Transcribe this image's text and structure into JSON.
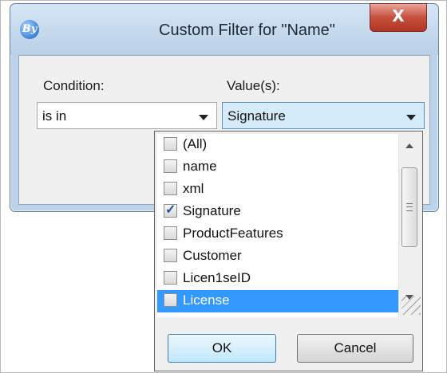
{
  "dialog": {
    "title": "Custom Filter for \"Name\"",
    "app_icon": "app-logo-icon",
    "app_icon_text": "By",
    "close_label": "X"
  },
  "condition": {
    "label": "Condition:",
    "selected": "is in"
  },
  "values": {
    "label": "Value(s):",
    "selected": "Signature"
  },
  "list_items": [
    {
      "label": "(All)",
      "checked": false,
      "highlighted": false
    },
    {
      "label": "name",
      "checked": false,
      "highlighted": false
    },
    {
      "label": "xml",
      "checked": false,
      "highlighted": false
    },
    {
      "label": "Signature",
      "checked": true,
      "highlighted": false
    },
    {
      "label": "ProductFeatures",
      "checked": false,
      "highlighted": false
    },
    {
      "label": "Customer",
      "checked": false,
      "highlighted": false
    },
    {
      "label": "Licen1seID",
      "checked": false,
      "highlighted": false
    },
    {
      "label": "License",
      "checked": false,
      "highlighted": true
    }
  ],
  "buttons": {
    "ok": "OK",
    "cancel": "Cancel"
  },
  "colors": {
    "selection": "#3399ff",
    "titlebar": "#bcd3ea",
    "close": "#c6503e"
  }
}
